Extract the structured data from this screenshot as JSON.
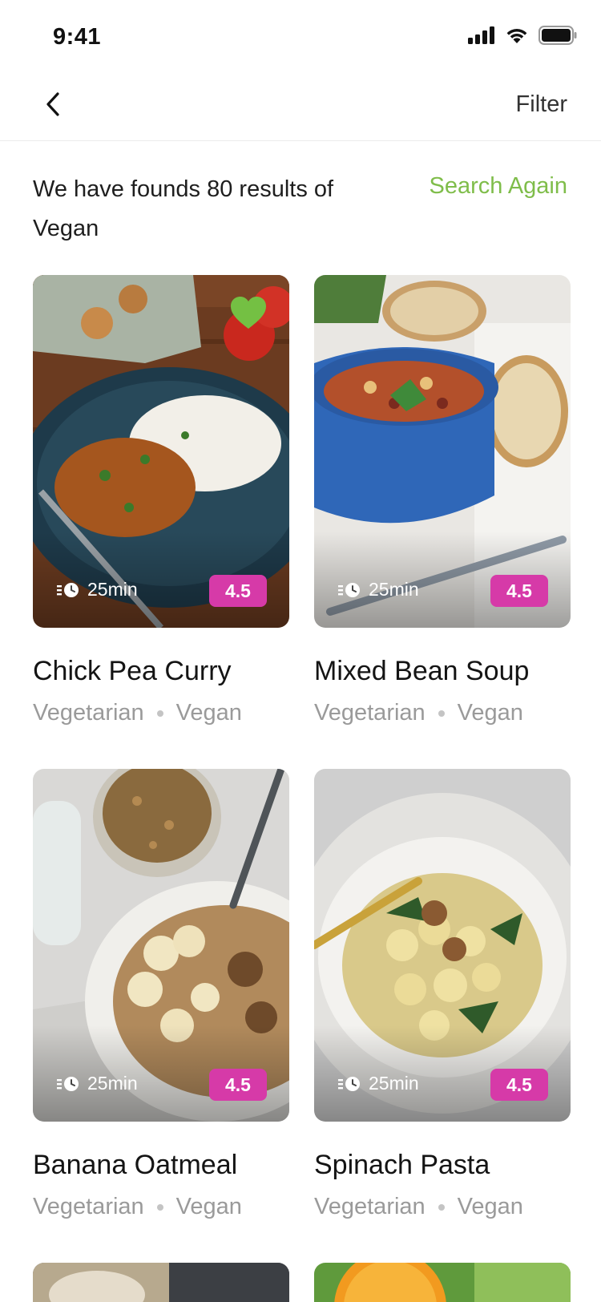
{
  "status_bar": {
    "time": "9:41"
  },
  "nav": {
    "filter_label": "Filter"
  },
  "results": {
    "text": "We have founds 80 results of Vegan",
    "search_again_label": "Search Again"
  },
  "colors": {
    "accent_green": "#7fbd4a",
    "rating_pink": "#d63aa8",
    "favorite_green": "#74c043"
  },
  "recipes": [
    {
      "title": "Chick Pea Curry",
      "time": "25min",
      "rating": "4.5",
      "tag1": "Vegetarian",
      "tag2": "Vegan",
      "favorite": true
    },
    {
      "title": "Mixed Bean Soup",
      "time": "25min",
      "rating": "4.5",
      "tag1": "Vegetarian",
      "tag2": "Vegan",
      "favorite": false
    },
    {
      "title": "Banana Oatmeal",
      "time": "25min",
      "rating": "4.5",
      "tag1": "Vegetarian",
      "tag2": "Vegan",
      "favorite": false
    },
    {
      "title": "Spinach Pasta",
      "time": "25min",
      "rating": "4.5",
      "tag1": "Vegetarian",
      "tag2": "Vegan",
      "favorite": false
    }
  ]
}
